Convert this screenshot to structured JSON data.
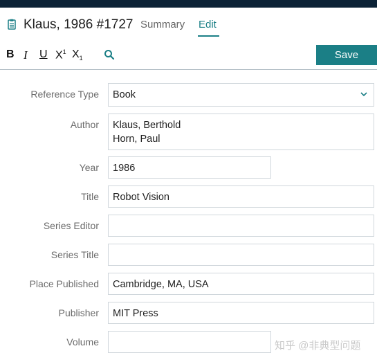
{
  "header": {
    "reference_title": "Klaus, 1986 #1727",
    "tabs": [
      {
        "label": "Summary",
        "active": false
      },
      {
        "label": "Edit",
        "active": true
      }
    ]
  },
  "toolbar": {
    "bold": "B",
    "italic": "I",
    "underline": "U",
    "superscript_base": "X",
    "superscript_mark": "1",
    "subscript_base": "X",
    "subscript_mark": "1",
    "save_label": "Save"
  },
  "fields": {
    "reference_type": {
      "label": "Reference Type",
      "value": "Book"
    },
    "author": {
      "label": "Author",
      "value_line1": "Klaus, Berthold",
      "value_line2": "Horn, Paul"
    },
    "year": {
      "label": "Year",
      "value": "1986"
    },
    "title": {
      "label": "Title",
      "value": "Robot Vision"
    },
    "series_editor": {
      "label": "Series Editor",
      "value": ""
    },
    "series_title": {
      "label": "Series Title",
      "value": ""
    },
    "place_published": {
      "label": "Place Published",
      "value": "Cambridge, MA, USA"
    },
    "publisher": {
      "label": "Publisher",
      "value": "MIT Press"
    },
    "volume": {
      "label": "Volume",
      "value": ""
    }
  },
  "watermark": "知乎 @非典型问题",
  "colors": {
    "accent": "#1b7f86",
    "topbar": "#0c2236"
  }
}
